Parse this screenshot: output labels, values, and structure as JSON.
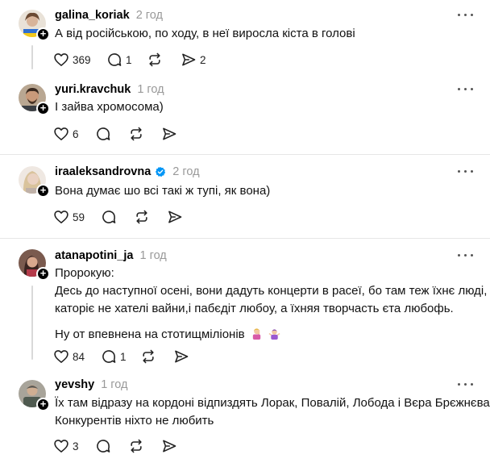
{
  "posts": [
    {
      "username": "galina_koriak",
      "time": "2 год",
      "lines": [
        "А від російською, по ходу, в неї виросла кіста в голові"
      ],
      "likes": "369",
      "comments": "1",
      "shares": "2"
    },
    {
      "username": "yuri.kravchuk",
      "time": "1 год",
      "lines": [
        "І зайва хромосома)"
      ],
      "likes": "6"
    },
    {
      "username": "iraaleksandrovna",
      "time": "2 год",
      "verified": true,
      "lines": [
        "Вона думає шо всі такі ж тупі, як вона)"
      ],
      "likes": "59"
    },
    {
      "username": "atanapotini_ja",
      "time": "1 год",
      "lines": [
        "Пророкую:",
        "Десь до наступної осені, вони дадуть концерти в расеї, бо там теж їхнє люді,",
        "каторіє не хателі вайни,і пабєдіт любоу, а їхняя творчасть єта любофь.",
        "Ну от впевнена на стотищміліонів"
      ],
      "likes": "84",
      "comments": "1"
    },
    {
      "username": "yevshy",
      "time": "1 год",
      "lines": [
        "Їх там відразу на кордоні відпиздять Лорак, Повалій, Лобода і Вєра Брєжнєва.",
        "Конкурентів ніхто не любить"
      ],
      "likes": "3"
    }
  ],
  "icons": {
    "like": "heart-icon",
    "comment": "comment-icon",
    "repost": "repost-icon",
    "share": "share-icon",
    "more": "more-icon",
    "verified": "verified-badge-icon"
  },
  "colors": {
    "verified": "#0095f6",
    "muted": "#999999",
    "divider": "#e6e6e6"
  }
}
